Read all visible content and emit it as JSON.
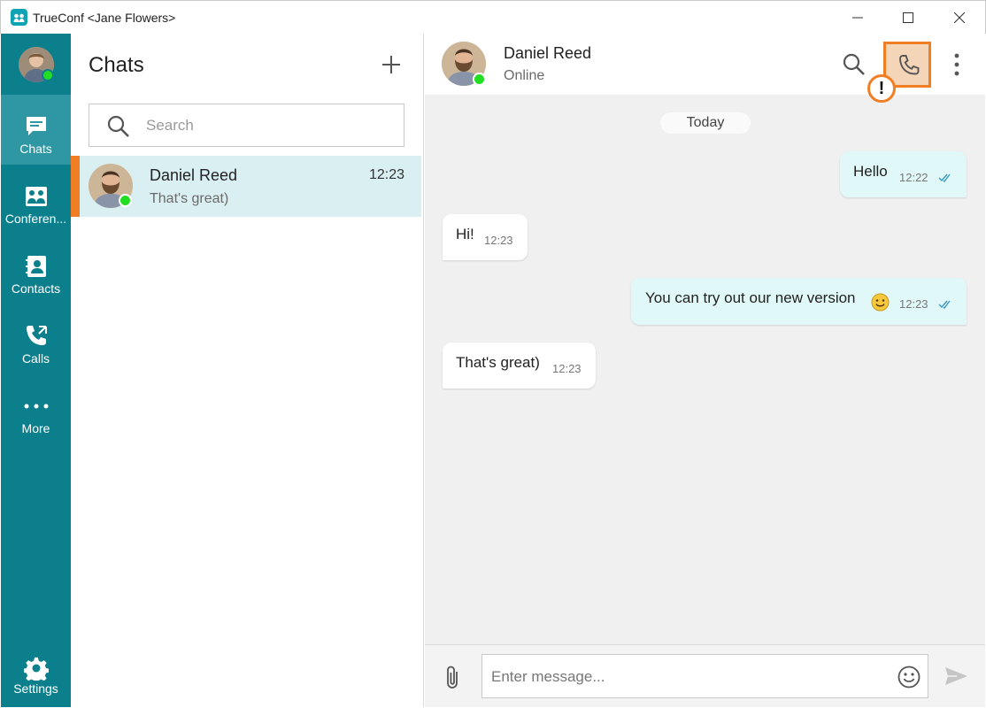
{
  "window": {
    "title": "TrueConf <Jane Flowers>"
  },
  "nav": {
    "items": [
      {
        "label": "Chats",
        "icon": "chat-bubble-icon",
        "active": true
      },
      {
        "label": "Conferen...",
        "icon": "conference-icon",
        "active": false
      },
      {
        "label": "Contacts",
        "icon": "contacts-book-icon",
        "active": false
      },
      {
        "label": "Calls",
        "icon": "phone-calls-icon",
        "active": false
      },
      {
        "label": "More",
        "icon": "more-dots-icon",
        "active": false
      }
    ],
    "settings_label": "Settings"
  },
  "chat_list": {
    "title": "Chats",
    "search_placeholder": "Search",
    "items": [
      {
        "name": "Daniel Reed",
        "time": "12:23",
        "preview": "That's great)",
        "online": true,
        "selected": true
      }
    ]
  },
  "conversation": {
    "contact_name": "Daniel Reed",
    "contact_status": "Online",
    "date_separator": "Today",
    "alert_mark": "!",
    "messages": [
      {
        "direction": "out",
        "text": "Hello",
        "time": "12:22",
        "read": true
      },
      {
        "direction": "in",
        "text": "Hi!",
        "time": "12:23"
      },
      {
        "direction": "out",
        "text": "You can try out our new version",
        "time": "12:23",
        "read": true,
        "emoji": "slightly-smiling-face"
      },
      {
        "direction": "in",
        "text": "That's great)",
        "time": "12:23"
      }
    ],
    "composer_placeholder": "Enter message..."
  },
  "colors": {
    "nav_background": "#0c7f8c",
    "nav_active": "#2e97a3",
    "accent_orange": "#f07e24",
    "selected_row": "#daeff2",
    "outgoing_bubble": "#e1f8f8",
    "online": "#22dd22"
  }
}
